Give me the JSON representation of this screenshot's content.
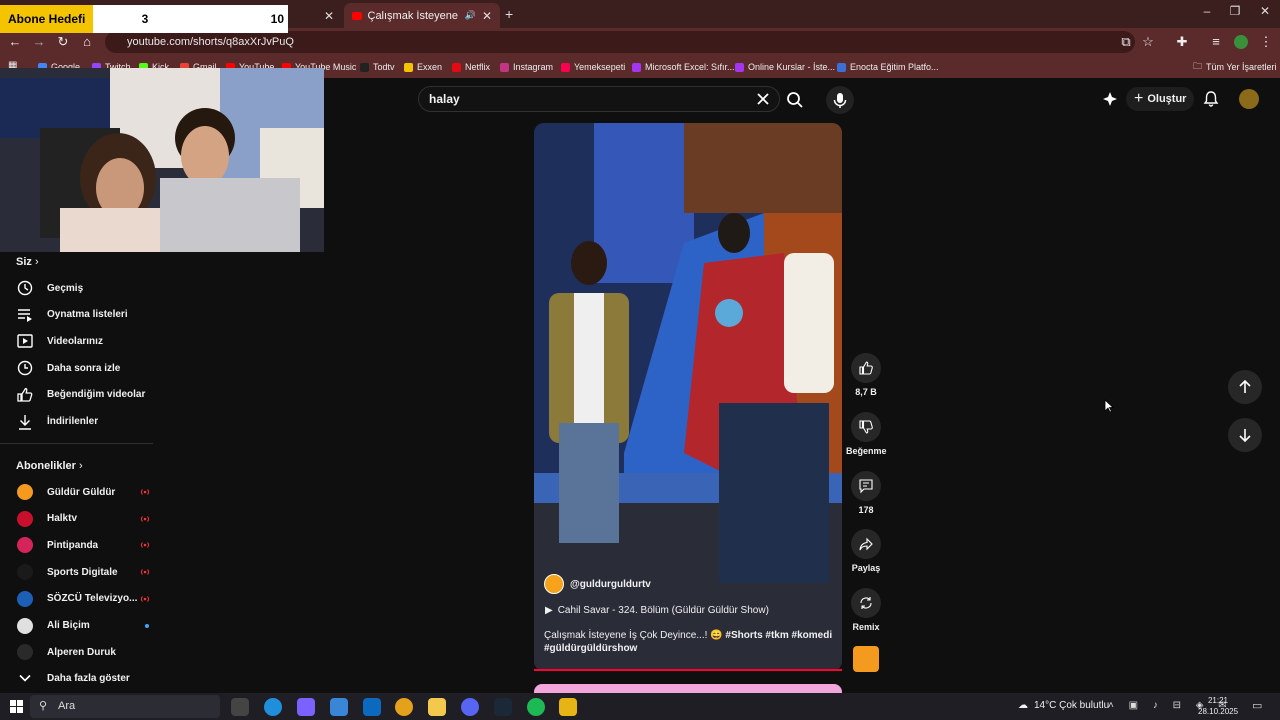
{
  "overlay": {
    "label": "Abone Hedefi",
    "current": "3",
    "goal": "10"
  },
  "browser": {
    "active_tab_title": "Çalışmak İsteyene İş Çok De",
    "url": "youtube.com/shorts/q8axXrJvPuQ",
    "bookmarks": [
      {
        "label": "Google",
        "color": "#4285f4"
      },
      {
        "label": "Twitch",
        "color": "#9146ff"
      },
      {
        "label": "Kick",
        "color": "#53fc18"
      },
      {
        "label": "Gmail",
        "color": "#ea4335"
      },
      {
        "label": "YouTube",
        "color": "#ff0000"
      },
      {
        "label": "YouTube Music",
        "color": "#ff0000"
      },
      {
        "label": "Todtv",
        "color": "#222222"
      },
      {
        "label": "Exxen",
        "color": "#f5c400"
      },
      {
        "label": "Netflix",
        "color": "#e50914"
      },
      {
        "label": "Instagram",
        "color": "#c13584"
      },
      {
        "label": "Yemeksepeti",
        "color": "#fa0050"
      },
      {
        "label": "Microsoft Excel: Sıfır...",
        "color": "#a435f0"
      },
      {
        "label": "Online Kurslar - İste...",
        "color": "#a435f0"
      },
      {
        "label": "Enocta Eğitim Platfo...",
        "color": "#3a6fd8"
      }
    ],
    "all_bookmarks": "Tüm Yer İşaretleri"
  },
  "youtube": {
    "search_value": "halay",
    "create_label": "Oluştur",
    "sidebar": {
      "you_heading": "Siz",
      "you_items": [
        {
          "label": "Geçmiş",
          "icon": "history-icon"
        },
        {
          "label": "Oynatma listeleri",
          "icon": "playlists-icon"
        },
        {
          "label": "Videolarınız",
          "icon": "your-videos-icon"
        },
        {
          "label": "Daha sonra izle",
          "icon": "watch-later-icon"
        },
        {
          "label": "Beğendiğim videolar",
          "icon": "liked-videos-icon"
        },
        {
          "label": "İndirilenler",
          "icon": "downloads-icon"
        }
      ],
      "subs_heading": "Abonelikler",
      "subs": [
        {
          "label": "Güldür Güldür",
          "color": "#f39a1f",
          "status": "live"
        },
        {
          "label": "Halktv",
          "color": "#c8102e",
          "status": "live"
        },
        {
          "label": "Pintipanda",
          "color": "#d4245a",
          "status": "live"
        },
        {
          "label": "Sports Digitale",
          "color": "#1a1a1a",
          "status": "live"
        },
        {
          "label": "SÖZCÜ Televizyo...",
          "color": "#1d5fb6",
          "status": "live"
        },
        {
          "label": "Ali Biçim",
          "color": "#e0e0e0",
          "status": "new"
        },
        {
          "label": "Alperen Duruk",
          "color": "#2a2a2a",
          "status": ""
        }
      ],
      "show_more": "Daha fazla göster"
    },
    "short": {
      "channel": "@guldurguldurtv",
      "episode": "Cahil Savar - 324. Bölüm (Güldür Güldür Show)",
      "caption_text": "Çalışmak İsteyene İş Çok Deyince...! 😄",
      "hashtags": "#Shorts #tkm #komedi #güldürgüldürshow",
      "likes": "8,7 B",
      "dislike_label": "Beğenme",
      "comments": "178",
      "share_label": "Paylaş",
      "remix_label": "Remix"
    }
  },
  "taskbar": {
    "search_placeholder": "Ara",
    "weather": "14°C  Çok bulutlu",
    "time": "21:21",
    "date": "28.10.2025"
  }
}
